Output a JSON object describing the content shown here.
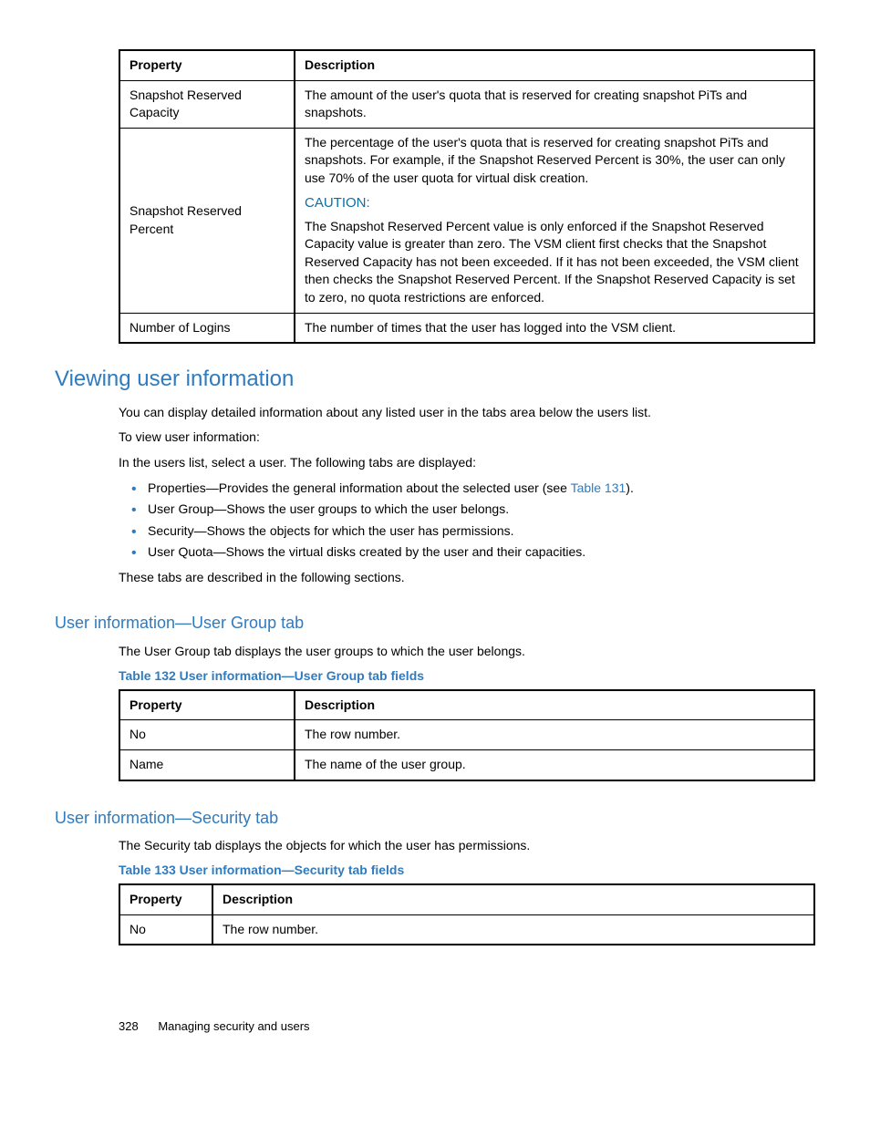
{
  "table1": {
    "headers": [
      "Property",
      "Description"
    ],
    "rows": [
      {
        "prop": "Snapshot Reserved Capacity",
        "desc_plain": "The amount of the user's quota that is reserved for creating snapshot PiTs and snapshots."
      },
      {
        "prop": "Snapshot Reserved Percent",
        "desc_p1": "The percentage of the user's quota that is reserved for creating snapshot PiTs and snapshots. For example, if the Snapshot Reserved Percent is 30%, the user can only use 70% of the user quota for virtual disk creation.",
        "caution_label": "CAUTION:",
        "desc_p2": "The Snapshot Reserved Percent value is only enforced if the Snapshot Reserved Capacity value is greater than zero. The VSM client first checks that the Snapshot Reserved Capacity has not been exceeded. If it has not been exceeded, the VSM client then checks the Snapshot Reserved Percent. If the Snapshot Reserved Capacity is set to zero, no quota restrictions are enforced."
      },
      {
        "prop": "Number of Logins",
        "desc_plain": "The number of times that the user has logged into the VSM client."
      }
    ]
  },
  "section1": {
    "title": "Viewing user information",
    "p1": "You can display detailed information about any listed user in the tabs area below the users list.",
    "p2": "To view user information:",
    "p3": "In the users list, select a user. The following tabs are displayed:",
    "bullets": {
      "b1_pre": "Properties—Provides the general information about the selected user (see ",
      "b1_link": "Table 131",
      "b1_post": ").",
      "b2": "User Group—Shows the user groups to which the user belongs.",
      "b3": "Security—Shows the objects for which the user has permissions.",
      "b4": "User Quota—Shows the virtual disks created by the user and their capacities."
    },
    "p4": "These tabs are described in the following sections."
  },
  "section2": {
    "title": "User information—User Group tab",
    "p1": "The User Group tab displays the user groups to which the user belongs.",
    "caption": "Table 132 User information—User Group tab fields",
    "headers": [
      "Property",
      "Description"
    ],
    "rows": [
      {
        "prop": "No",
        "desc": "The row number."
      },
      {
        "prop": "Name",
        "desc": "The name of the user group."
      }
    ]
  },
  "section3": {
    "title": "User information—Security tab",
    "p1": "The Security tab displays the objects for which the user has permissions.",
    "caption": "Table 133 User information—Security tab fields",
    "headers": [
      "Property",
      "Description"
    ],
    "rows": [
      {
        "prop": "No",
        "desc": "The row number."
      }
    ]
  },
  "footer": {
    "page": "328",
    "chapter": "Managing security and users"
  }
}
